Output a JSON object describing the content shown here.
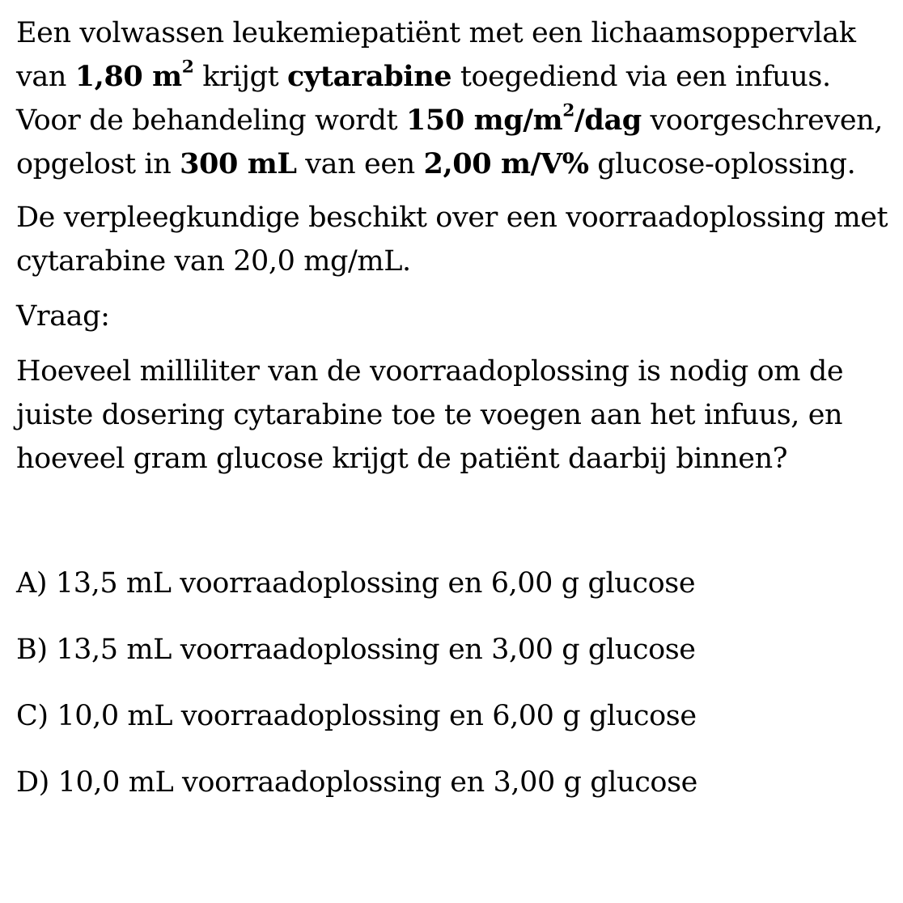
{
  "intro": {
    "t1": "Een volwassen leukemiepatiënt met een lichaamsoppervlak van ",
    "bsa": "1,80 m",
    "bsa_sup": "2",
    "t2": " krijgt ",
    "drug": "cytarabine",
    "t3": " toegediend via een infuus. Voor de behandeling wordt ",
    "dose": "150 mg/m",
    "dose_sup": "2",
    "dose_tail": "/dag",
    "t4": " voorgeschreven, opgelost in ",
    "volume": "300 mL",
    "t5": " van een ",
    "concentration": "2,00 m/V%",
    "t6": " glucose-oplossing."
  },
  "stock": "De verpleegkundige beschikt over een voorraadoplossing met cytarabine van 20,0 mg/mL.",
  "question_label": "Vraag:",
  "question": "Hoeveel milliliter van de voorraadoplossing is nodig om de juiste dosering cytarabine toe te voegen aan het infuus, en hoeveel gram glucose krijgt de patiënt daarbij binnen?",
  "options": [
    "A) 13,5 mL voorraadoplossing en 6,00 g glucose",
    "B) 13,5 mL voorraadoplossing en 3,00 g glucose",
    "C) 10,0 mL voorraadoplossing en 6,00 g glucose",
    "D) 10,0 mL voorraadoplossing en 3,00 g glucose"
  ]
}
